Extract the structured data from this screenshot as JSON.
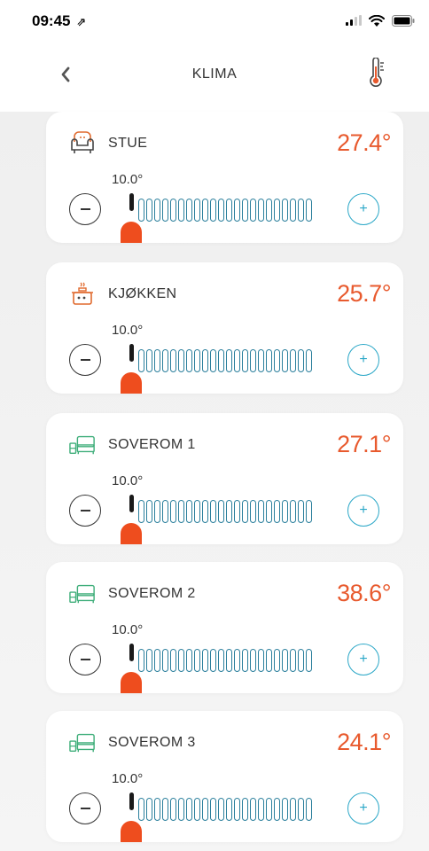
{
  "status_bar": {
    "time": "09:45",
    "arrow": "⇗"
  },
  "nav": {
    "title": "KLIMA"
  },
  "rooms": [
    {
      "name": "STUE",
      "temperature": "27.4°",
      "setpoint": "10.0°",
      "icon": "armchair-icon",
      "minus": "−",
      "plus": "+"
    },
    {
      "name": "KJØKKEN",
      "temperature": "25.7°",
      "setpoint": "10.0°",
      "icon": "cooking-pot-icon",
      "minus": "−",
      "plus": "+"
    },
    {
      "name": "SOVEROM 1",
      "temperature": "27.1°",
      "setpoint": "10.0°",
      "icon": "bed-icon",
      "minus": "−",
      "plus": "+"
    },
    {
      "name": "SOVEROM 2",
      "temperature": "38.6°",
      "setpoint": "10.0°",
      "icon": "bed-icon",
      "minus": "−",
      "plus": "+"
    },
    {
      "name": "SOVEROM 3",
      "temperature": "24.1°",
      "setpoint": "10.0°",
      "icon": "bed-icon",
      "minus": "−",
      "plus": "+"
    }
  ],
  "colors": {
    "accent_temp": "#e85a2e",
    "handle": "#ee4d1e",
    "plus": "#2aa7c7",
    "tick": "#2a7f9c",
    "bed_green": "#3fae7a"
  }
}
